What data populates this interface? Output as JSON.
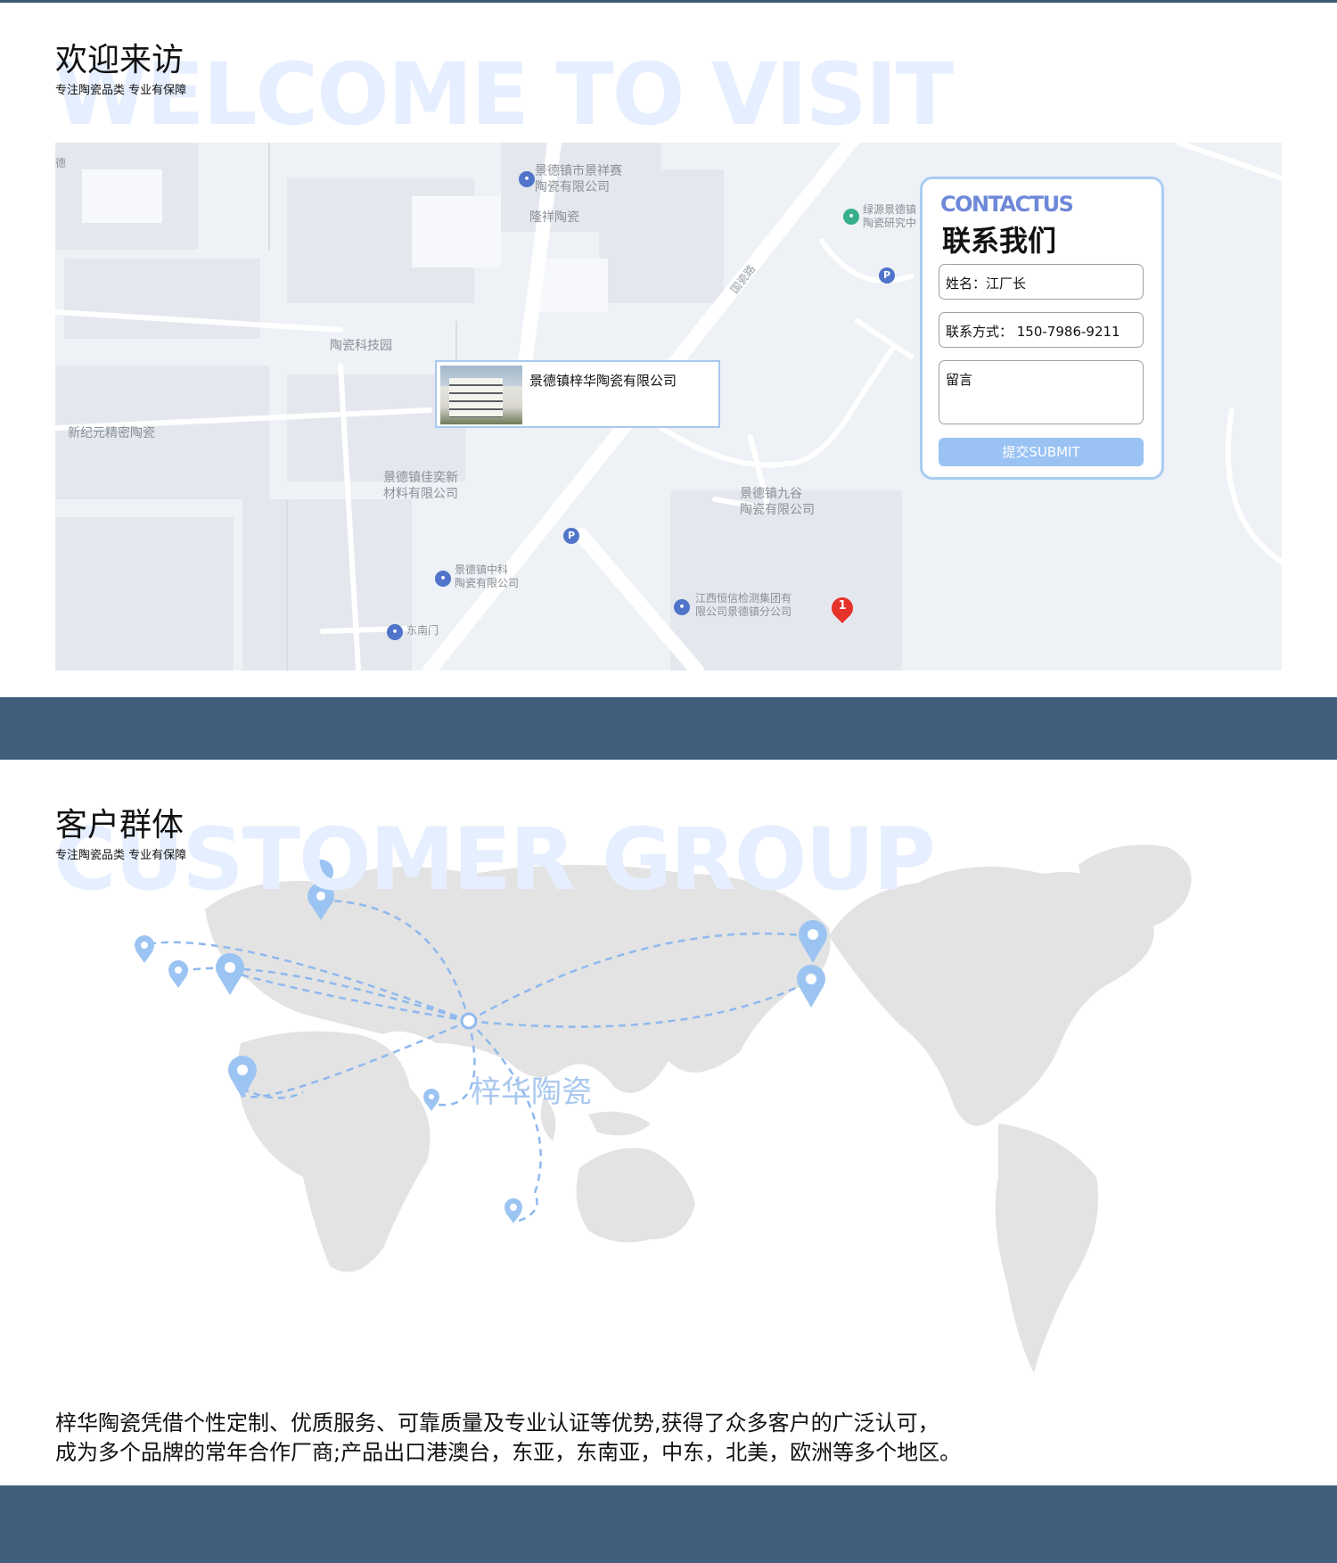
{
  "visit": {
    "ghost": "WELCOME TO VISIT",
    "title": "欢迎来访",
    "subtitle": "专注陶瓷品类  专业有保障"
  },
  "map": {
    "popup_company": "景德镇梓华陶瓷有限公司",
    "marker_number": "1",
    "labels": {
      "jingxiangsheng": "景德镇市景祥赛\n陶瓷有限公司",
      "longxiang": "隆祥陶瓷",
      "keji": "陶瓷科技园",
      "xinjiyuan": "新纪元精密陶瓷",
      "jiayi": "景德镇佳奕新\n材料有限公司",
      "jiugu": "景德镇九谷\n陶瓷有限公司",
      "zhongke": "景德镇中科\n陶瓷有限公司",
      "dongnanmen": "东南门",
      "hengxin": "江西恒信检测集团有\n限公司景德镇分公司",
      "lvyuan": "绿源景德镇\n陶瓷研究中",
      "road": "国瓷路",
      "edge": "德"
    }
  },
  "contact": {
    "title_en": "CONTACTUS",
    "title_cn": "联系我们",
    "name_field": "姓名：江厂长",
    "phone_field": "联系方式：  150-7986-9211",
    "message_placeholder": "留言",
    "submit_label": "提交SUBMIT"
  },
  "customers": {
    "ghost": "CUSTOMER GROUP",
    "title": "客户群体",
    "subtitle": "专注陶瓷品类  专业有保障",
    "center_label": "梓华陶瓷",
    "description_line1": "梓华陶瓷凭借个性定制、优质服务、可靠质量及专业认证等优势,获得了众多客户的广泛认可，",
    "description_line2": "成为多个品牌的常年合作厂商;产品出口港澳台，东亚，东南亚，中东，北美，欧洲等多个地区。"
  },
  "colors": {
    "band": "#3f5f7d",
    "accent_blue": "#9ac3f4",
    "ghost_text": "#e6efff"
  }
}
